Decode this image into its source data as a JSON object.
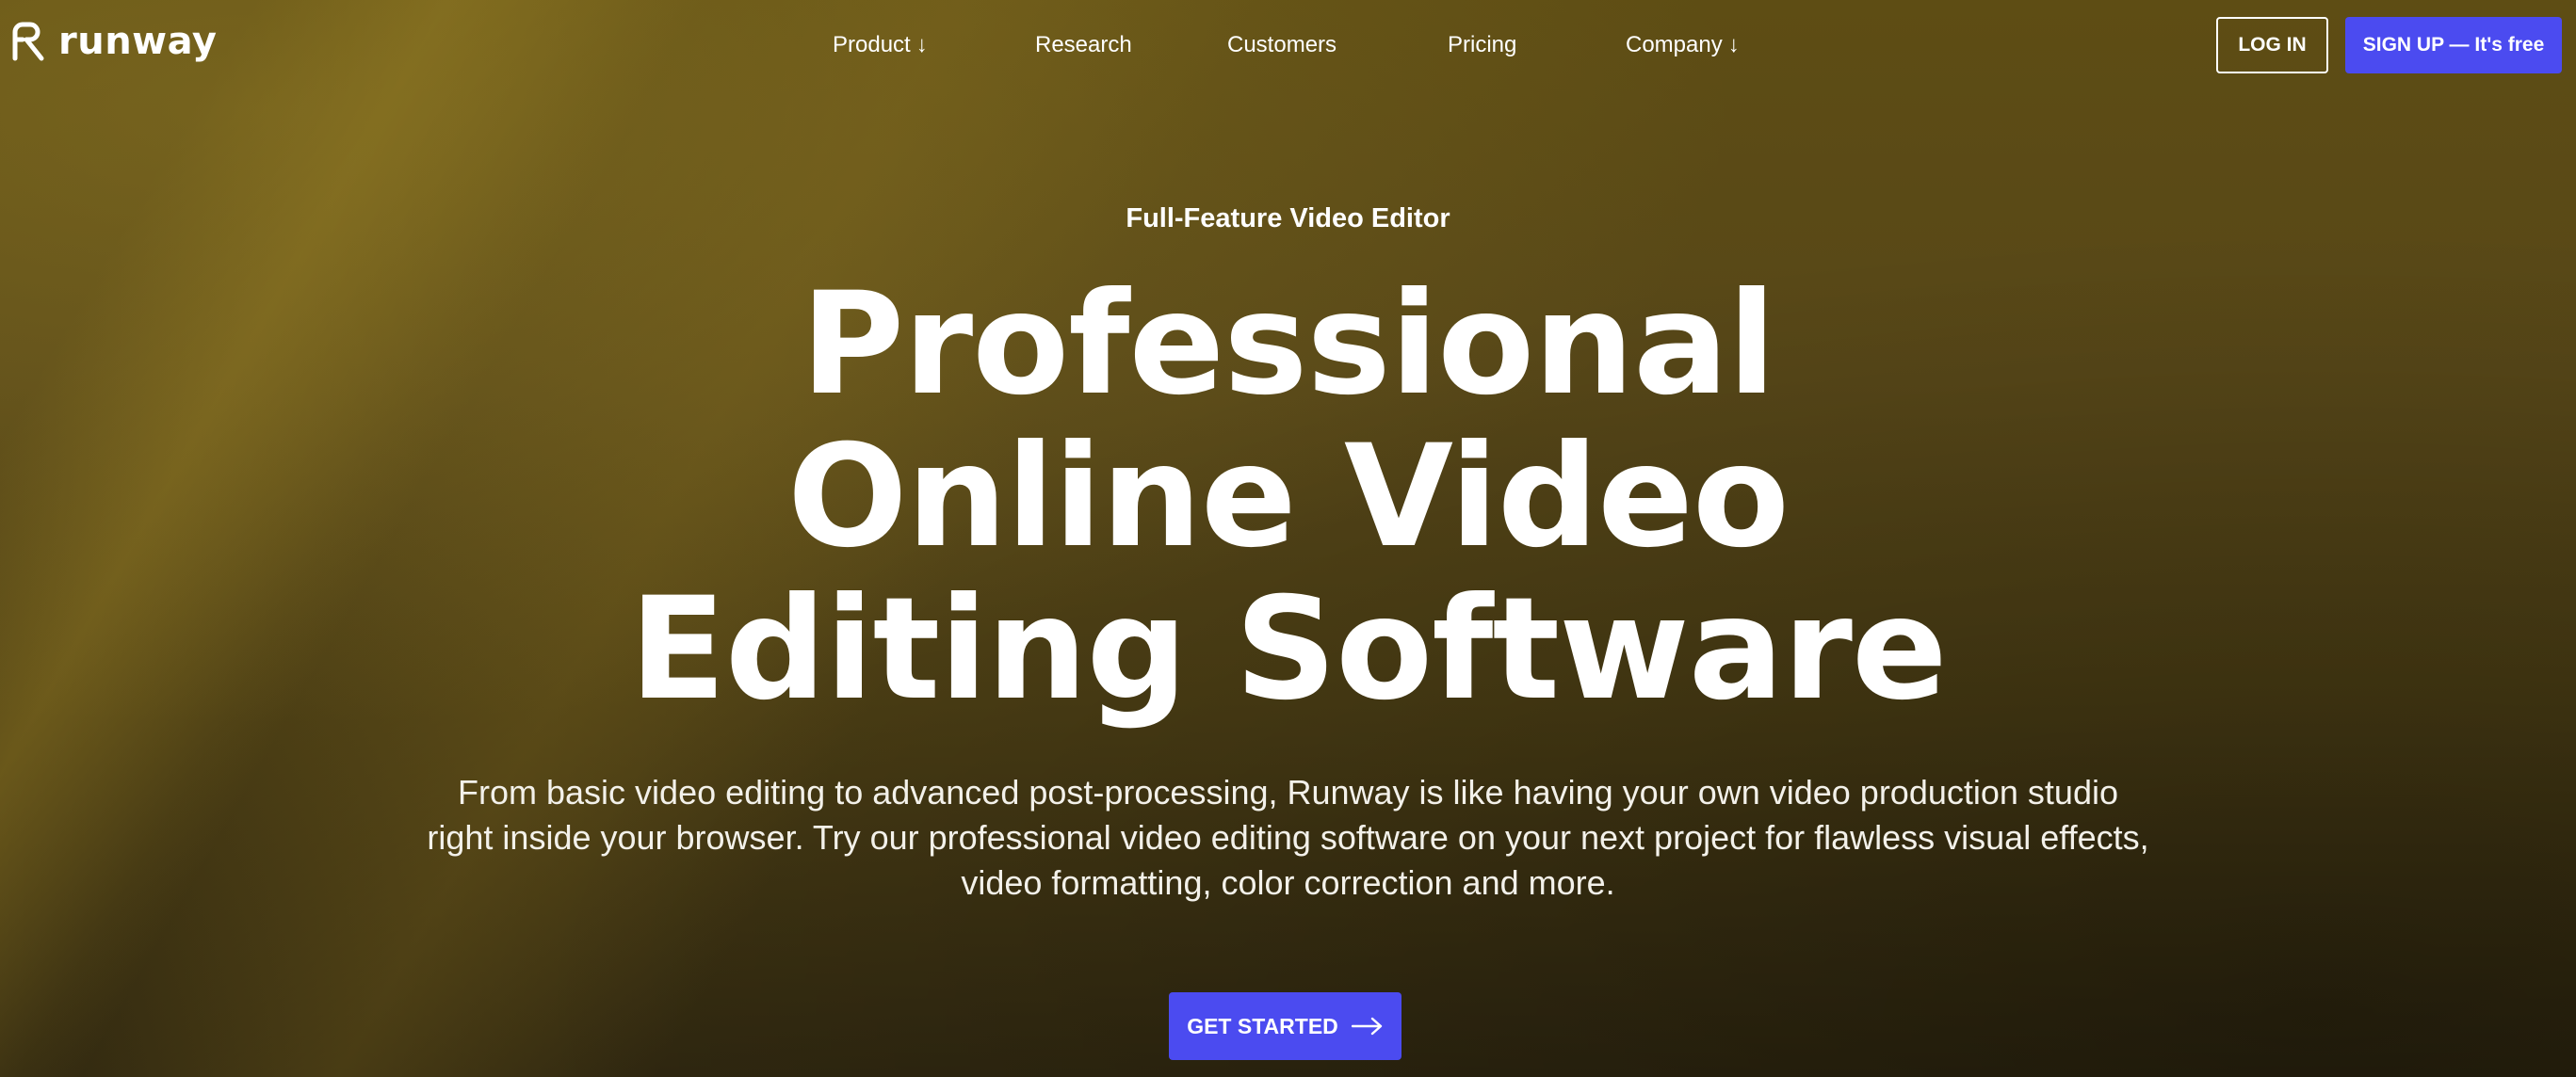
{
  "brand": {
    "name": "runway"
  },
  "nav": {
    "links": [
      {
        "label": "Product",
        "arrow": "↓"
      },
      {
        "label": "Research",
        "arrow": ""
      },
      {
        "label": "Customers",
        "arrow": ""
      },
      {
        "label": "Pricing",
        "arrow": ""
      },
      {
        "label": "Company",
        "arrow": "↓"
      }
    ],
    "login_label": "LOG IN",
    "signup_label": "SIGN UP — It's free"
  },
  "hero": {
    "eyebrow": "Full-Feature Video Editor",
    "title_lines": [
      "Professional",
      "Online Video",
      "Editing Software"
    ],
    "subtitle": "From basic video editing to advanced post-processing, Runway is like having your own video production studio right inside your browser. Try our professional video editing software on your next project for flawless visual effects, video formatting, color correction and more.",
    "cta_label": "GET STARTED"
  },
  "colors": {
    "accent": "#4b4bf0",
    "background": "#4f4216",
    "text": "#ffffff"
  },
  "icons": {
    "logo": "runway-logo-icon",
    "cta": "arrow-right-icon",
    "dropdown": "arrow-down-icon"
  }
}
